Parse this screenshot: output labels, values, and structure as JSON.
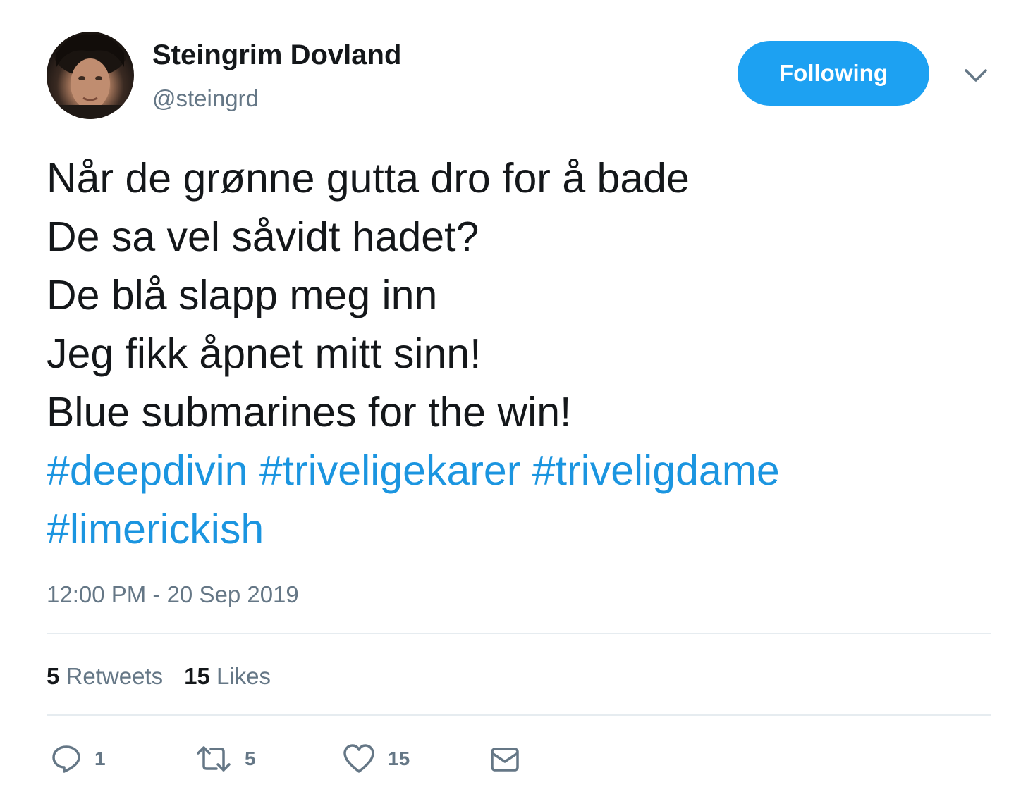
{
  "author": {
    "name": "Steingrim Dovland",
    "handle": "@steingrd"
  },
  "follow_button": {
    "label": "Following"
  },
  "tweet": {
    "lines": [
      "Når de grønne gutta dro for å bade",
      "De sa vel såvidt hadet?",
      "De blå slapp meg inn",
      "Jeg fikk åpnet mitt sinn!",
      "Blue submarines for the win!"
    ],
    "hashtags": [
      "#deepdivin",
      "#triveligekarer",
      "#triveligdame",
      "#limerickish"
    ]
  },
  "timestamp": "12:00 PM - 20 Sep 2019",
  "stats": {
    "retweets": {
      "count": "5",
      "label": "Retweets"
    },
    "likes": {
      "count": "15",
      "label": "Likes"
    }
  },
  "actions": {
    "reply": {
      "icon": "reply-icon",
      "count": "1"
    },
    "retweet": {
      "icon": "retweet-icon",
      "count": "5"
    },
    "like": {
      "icon": "heart-icon",
      "count": "15"
    },
    "dm": {
      "icon": "envelope-icon"
    }
  },
  "colors": {
    "accent": "#1da1f2",
    "link": "#1b95e0",
    "secondary_text": "#657786",
    "primary_text": "#14171a",
    "divider": "#e6ecf0"
  }
}
